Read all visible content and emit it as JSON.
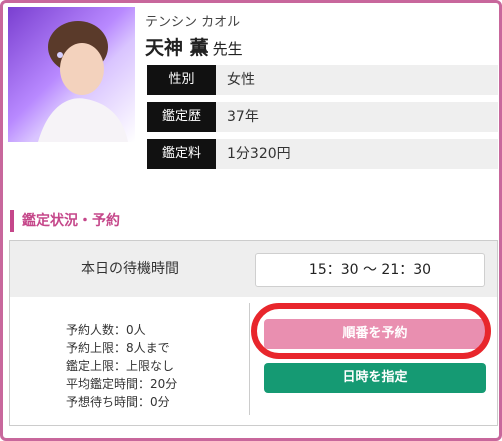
{
  "profile": {
    "kana": "テンシン カオル",
    "name": "天神 薫",
    "honorific": "先生",
    "photo_icon": "fortune-teller-portrait"
  },
  "info": [
    {
      "label": "性別",
      "value": "女性"
    },
    {
      "label": "鑑定歴",
      "value": "37年"
    },
    {
      "label": "鑑定料",
      "value": "1分320円"
    }
  ],
  "section": {
    "title": "鑑定状況・予約"
  },
  "wait": {
    "label": "本日の待機時間",
    "time": "15：30 ～ 21：30"
  },
  "stats": [
    "予約人数：0人",
    "予約上限：8人まで",
    "鑑定上限：上限なし",
    "平均鑑定時間：20分",
    "予想待ち時間：0分"
  ],
  "buttons": {
    "order": "順番を予約",
    "date": "日時を指定"
  },
  "colors": {
    "accent": "#c5478a",
    "order": "#e98fb0",
    "date": "#159a73",
    "highlight": "#e8262c"
  }
}
